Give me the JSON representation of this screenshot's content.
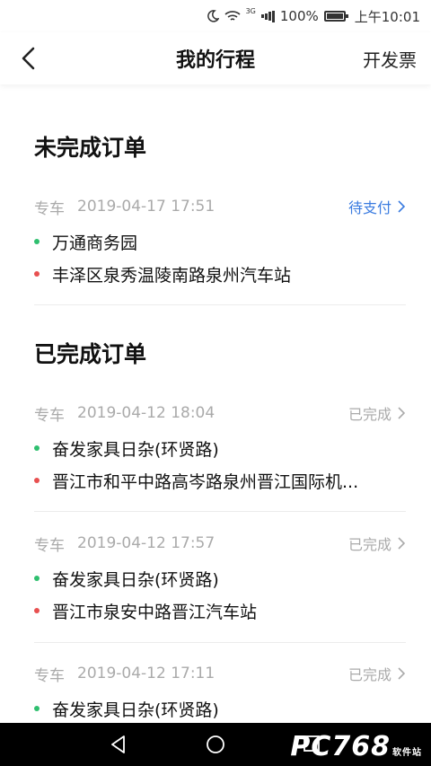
{
  "status_bar": {
    "network": "3G",
    "battery": "100%",
    "time": "上午10:01"
  },
  "header": {
    "title": "我的行程",
    "action_label": "开发票"
  },
  "sections": [
    {
      "title": "未完成订单",
      "orders": [
        {
          "type": "专车",
          "datetime": "2019-04-17 17:51",
          "status": "待支付",
          "from": "万通商务园",
          "to": "丰泽区泉秀温陵南路泉州汽车站"
        }
      ]
    },
    {
      "title": "已完成订单",
      "orders": [
        {
          "type": "专车",
          "datetime": "2019-04-12 18:04",
          "status": "已完成",
          "from": "奋发家具日杂(环贤路)",
          "to": "晋江市和平中路高岑路泉州晋江国际机..."
        },
        {
          "type": "专车",
          "datetime": "2019-04-12 17:57",
          "status": "已完成",
          "from": "奋发家具日杂(环贤路)",
          "to": "晋江市泉安中路晋江汽车站"
        },
        {
          "type": "专车",
          "datetime": "2019-04-12 17:11",
          "status": "已完成",
          "from": "奋发家具日杂(环贤路)",
          "to": ""
        }
      ]
    }
  ],
  "watermark": {
    "text": "PC768",
    "sub": "软件站"
  },
  "colors": {
    "pending": "#3a7be0",
    "origin_dot": "#2fbf6f",
    "dest_dot": "#e85050"
  }
}
